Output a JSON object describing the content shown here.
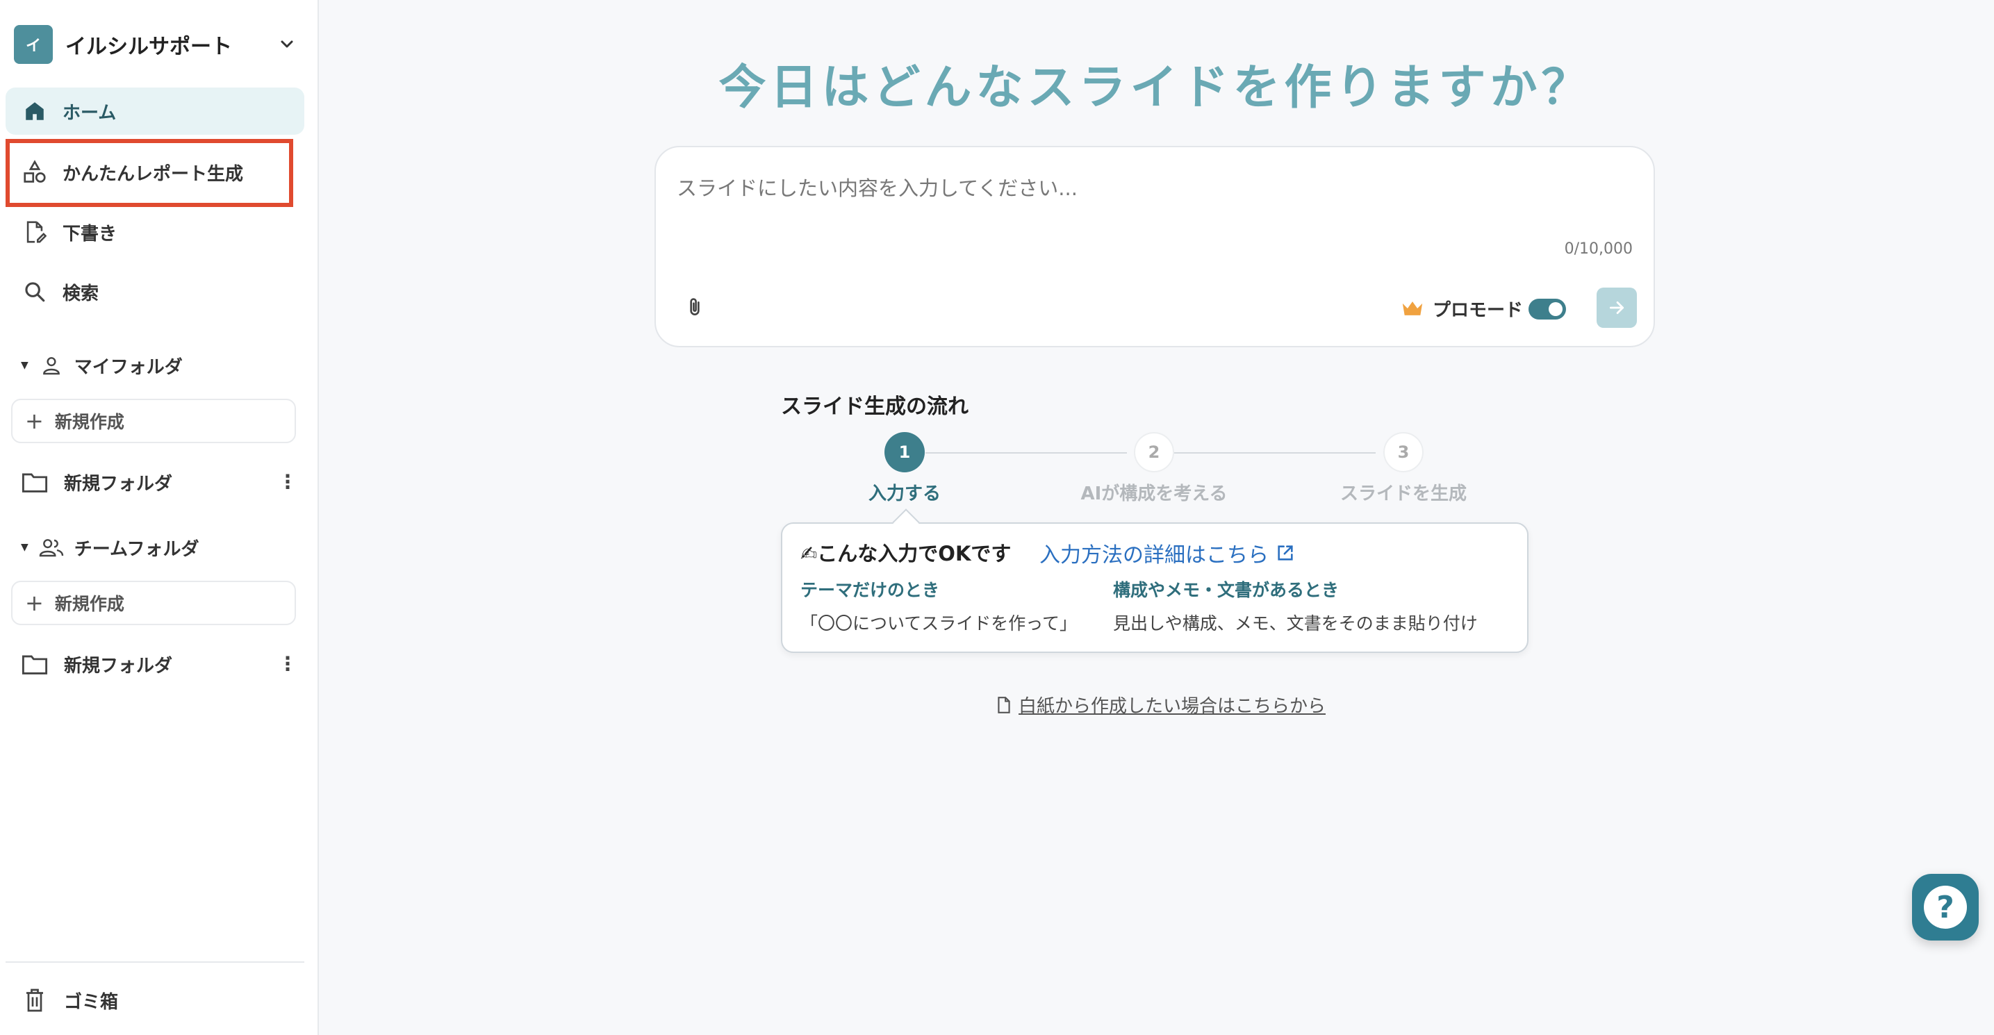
{
  "sidebar": {
    "workspace": {
      "avatar": "イ",
      "name": "イルシルサポート"
    },
    "nav": [
      {
        "label": "ホーム",
        "icon": "home-icon"
      },
      {
        "label": "かんたんレポート生成",
        "icon": "shapes-icon"
      },
      {
        "label": "下書き",
        "icon": "draft-icon"
      },
      {
        "label": "検索",
        "icon": "search-icon"
      }
    ],
    "my_folder": {
      "title": "マイフォルダ",
      "new_label": "新規作成",
      "folders": [
        "新規フォルダ"
      ]
    },
    "team_folder": {
      "title": "チームフォルダ",
      "new_label": "新規作成",
      "folders": [
        "新規フォルダ"
      ]
    },
    "trash_label": "ゴミ箱"
  },
  "main": {
    "title": "今日はどんなスライドを作りますか？",
    "input": {
      "placeholder": "スライドにしたい内容を入力してください...",
      "counter": "0/10,000"
    },
    "pro_mode": {
      "label": "プロモード",
      "enabled": true
    },
    "flow": {
      "title": "スライド生成の流れ",
      "steps": [
        {
          "num": "1",
          "label": "入力する",
          "active": true
        },
        {
          "num": "2",
          "label": "AIが構成を考える",
          "active": false
        },
        {
          "num": "3",
          "label": "スライドを生成",
          "active": false
        }
      ]
    },
    "tip": {
      "heading": "✍こんな入力でOKです",
      "link": "入力方法の詳細はこちら",
      "col1_title": "テーマだけのとき",
      "col1_text": "「〇〇についてスライドを作って」",
      "col2_title": "構成やメモ・文書があるとき",
      "col2_text": "見出しや構成、メモ、文書をそのまま貼り付け"
    },
    "blank_link": "白紙から作成したい場合はこちらから"
  },
  "colors": {
    "accent": "#3e7f8c",
    "title": "#6aa9b4",
    "highlight": "#e04a2f",
    "link": "#2a6fc0"
  }
}
